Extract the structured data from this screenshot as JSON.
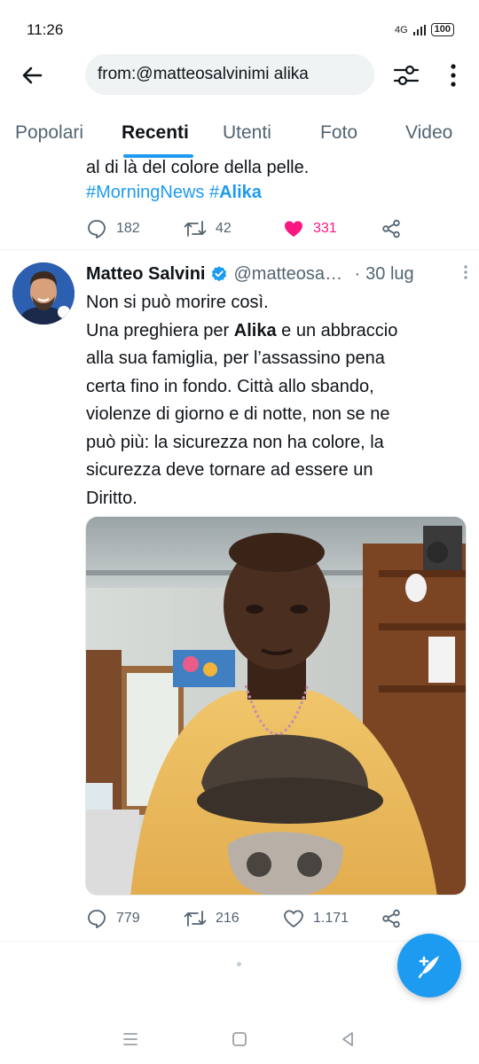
{
  "status_bar": {
    "time": "11:26",
    "network": "4G",
    "battery": "100"
  },
  "search": {
    "query": "from:@matteosalvinimi alika"
  },
  "tabs": [
    {
      "label": "Popolari"
    },
    {
      "label": "Recenti",
      "active": true
    },
    {
      "label": "Utenti"
    },
    {
      "label": "Foto"
    },
    {
      "label": "Video"
    }
  ],
  "partial_tweet": {
    "text_tail": "al di là del colore della pelle.",
    "hashtag1": "#MorningNews",
    "hashtag2_prefix": "#",
    "hashtag2_bold": "Alika",
    "replies": "182",
    "retweets": "42",
    "likes": "331"
  },
  "tweet": {
    "author": "Matteo Salvini",
    "handle": "@matteosalvinimi",
    "date": "30 lug",
    "body_line1": "Non si può morire così.",
    "body_line2_pre": "Una preghiera per ",
    "body_line2_bold": "Alika",
    "body_line2_post": " e un abbraccio",
    "body_line3": "alla sua famiglia, per l’assassino pena",
    "body_line4": "certa fino in fondo. Città allo sbando,",
    "body_line5": "violenze di giorno e di notte, non se ne",
    "body_line6": "può più: la sicurezza non ha colore, la",
    "body_line7": "sicurezza deve tornare ad essere un",
    "body_line8": "Diritto.",
    "replies": "779",
    "retweets": "216",
    "likes": "1.171"
  },
  "colors": {
    "accent": "#1d9bf0",
    "like": "#f91880",
    "muted": "#536471"
  },
  "icons": [
    "back-arrow-icon",
    "filter-icon",
    "more-vertical-icon",
    "reply-icon",
    "retweet-icon",
    "heart-icon",
    "share-icon",
    "verified-badge-icon",
    "compose-icon"
  ]
}
